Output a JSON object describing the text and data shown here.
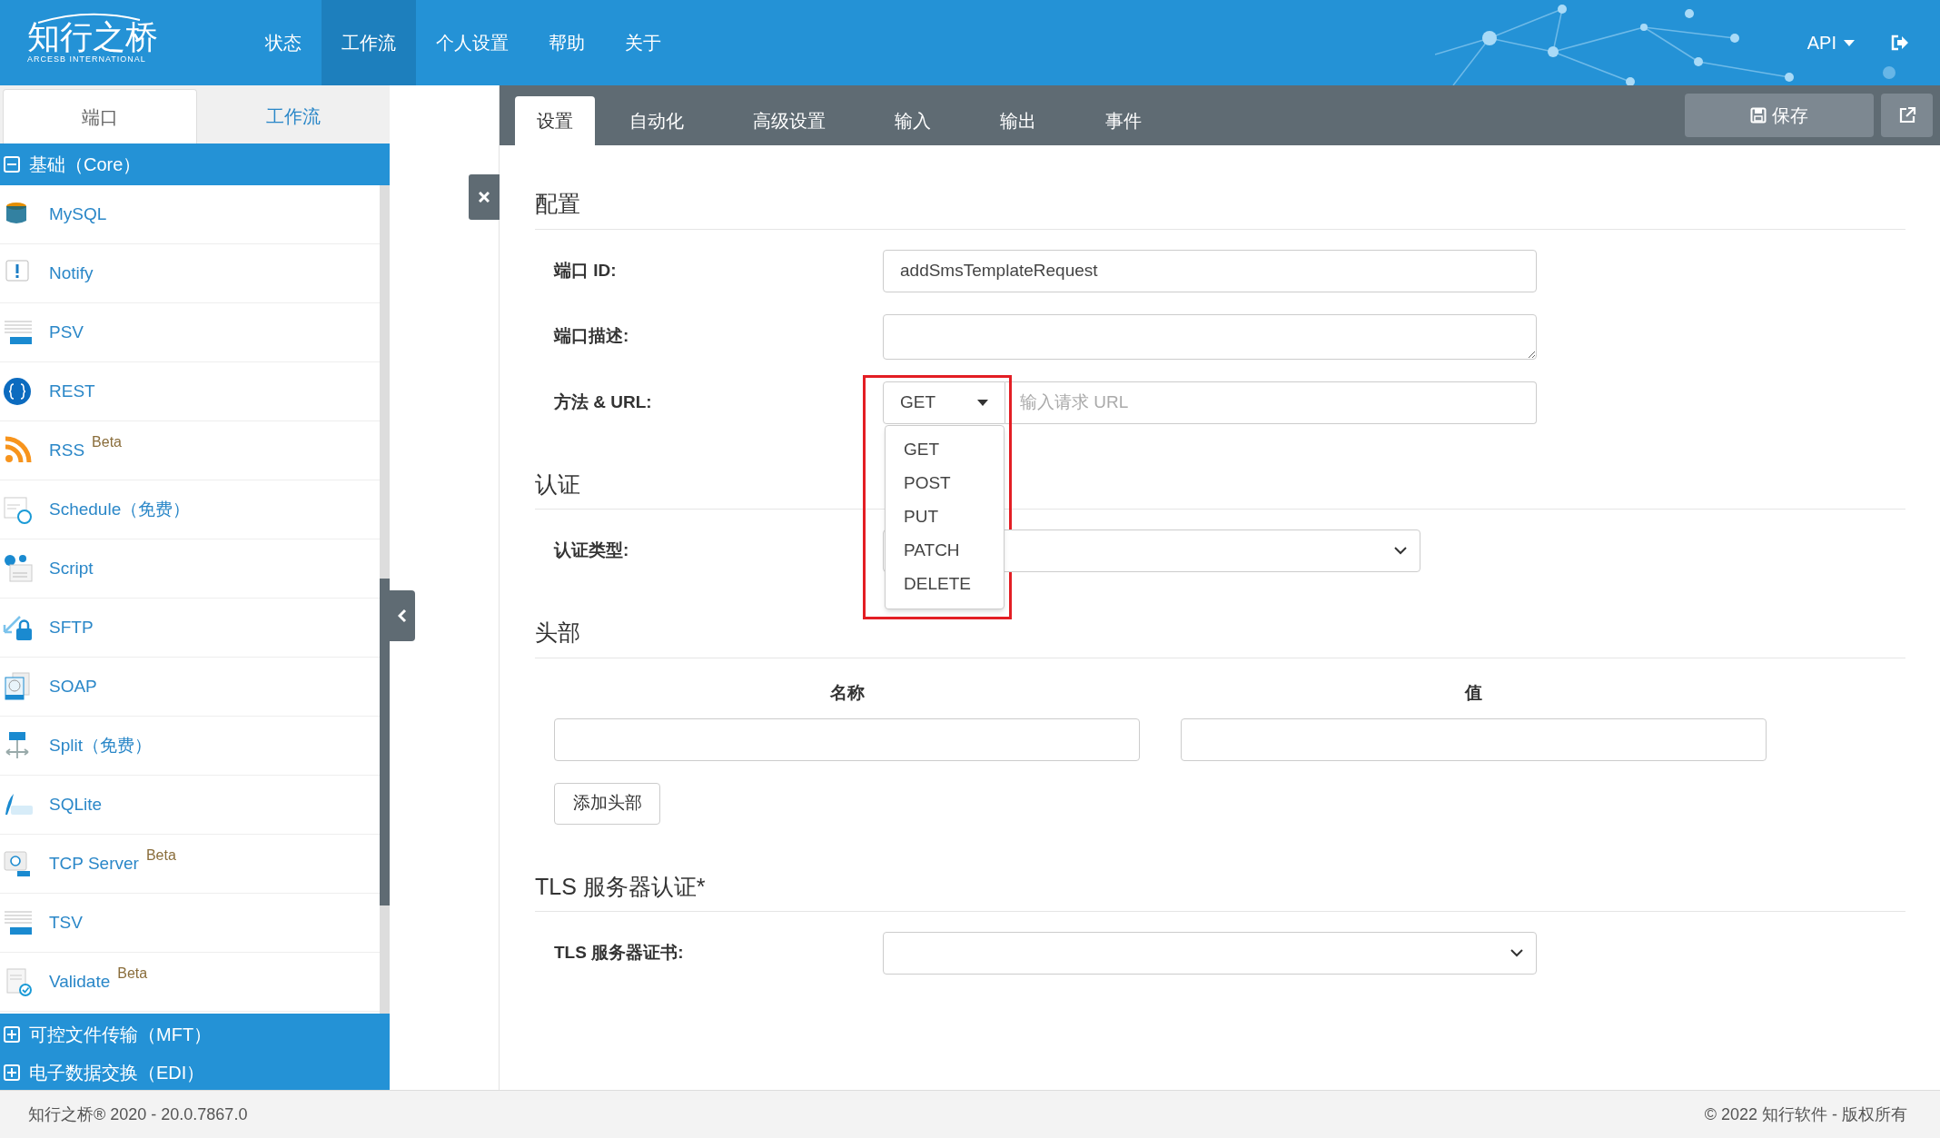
{
  "header": {
    "logo": {
      "title": "知行之桥",
      "subtitle": "ARCESB INTERNATIONAL"
    },
    "nav": [
      {
        "label": "状态",
        "selected": false
      },
      {
        "label": "工作流",
        "selected": true
      },
      {
        "label": "个人设置",
        "selected": false
      },
      {
        "label": "帮助",
        "selected": false
      },
      {
        "label": "关于",
        "selected": false
      }
    ],
    "api_menu": "API"
  },
  "sidebar": {
    "tabs": [
      {
        "label": "端口",
        "selected": true
      },
      {
        "label": "工作流",
        "selected": false
      }
    ],
    "groups": [
      {
        "label": "基础（Core）",
        "expanded": true,
        "items": [
          {
            "label": "MySQL",
            "kind": "mysql"
          },
          {
            "label": "Notify",
            "kind": "notify"
          },
          {
            "label": "PSV",
            "kind": "sheet"
          },
          {
            "label": "REST",
            "kind": "rest"
          },
          {
            "label": "RSS",
            "kind": "rss",
            "badge": "Beta"
          },
          {
            "label": "Schedule（免费）",
            "kind": "schedule"
          },
          {
            "label": "Script",
            "kind": "script"
          },
          {
            "label": "SFTP",
            "kind": "sftp"
          },
          {
            "label": "SOAP",
            "kind": "soap"
          },
          {
            "label": "Split（免费）",
            "kind": "split"
          },
          {
            "label": "SQLite",
            "kind": "sqlite"
          },
          {
            "label": "TCP Server",
            "kind": "tcp",
            "badge": "Beta"
          },
          {
            "label": "TSV",
            "kind": "sheet"
          },
          {
            "label": "Validate",
            "kind": "validate",
            "badge": "Beta"
          }
        ]
      },
      {
        "label": "可控文件传输（MFT）",
        "expanded": false
      },
      {
        "label": "电子数据交换（EDI）",
        "expanded": false
      }
    ]
  },
  "panel": {
    "tabs": [
      {
        "label": "设置",
        "selected": true
      },
      {
        "label": "自动化",
        "selected": false
      },
      {
        "label": "高级设置",
        "selected": false
      },
      {
        "label": "输入",
        "selected": false
      },
      {
        "label": "输出",
        "selected": false
      },
      {
        "label": "事件",
        "selected": false
      }
    ],
    "save_button": "保存",
    "sections": [
      {
        "title": "配置",
        "fields": [
          {
            "kind": "readonly",
            "label": "端口 ID:",
            "value": "addSmsTemplateRequest"
          },
          {
            "kind": "textarea",
            "label": "端口描述:"
          },
          {
            "kind": "method_url",
            "label": "方法 & URL:",
            "method": "GET",
            "placeholder": "输入请求 URL",
            "highlight": true,
            "options": [
              "GET",
              "POST",
              "PUT",
              "PATCH",
              "DELETE"
            ]
          }
        ]
      },
      {
        "title": "认证",
        "fields": [
          {
            "kind": "select",
            "label": "认证类型:"
          }
        ]
      },
      {
        "title": "头部",
        "kind": "headers",
        "columns": [
          "名称",
          "值"
        ],
        "add_button": "添加头部"
      },
      {
        "title": "TLS 服务器认证*",
        "fields": [
          {
            "kind": "select",
            "label": "TLS 服务器证书:"
          }
        ]
      }
    ]
  },
  "footer": {
    "version": "知行之桥® 2020 - 20.0.7867.0",
    "copyright": "© 2022 知行软件 - 版权所有"
  }
}
